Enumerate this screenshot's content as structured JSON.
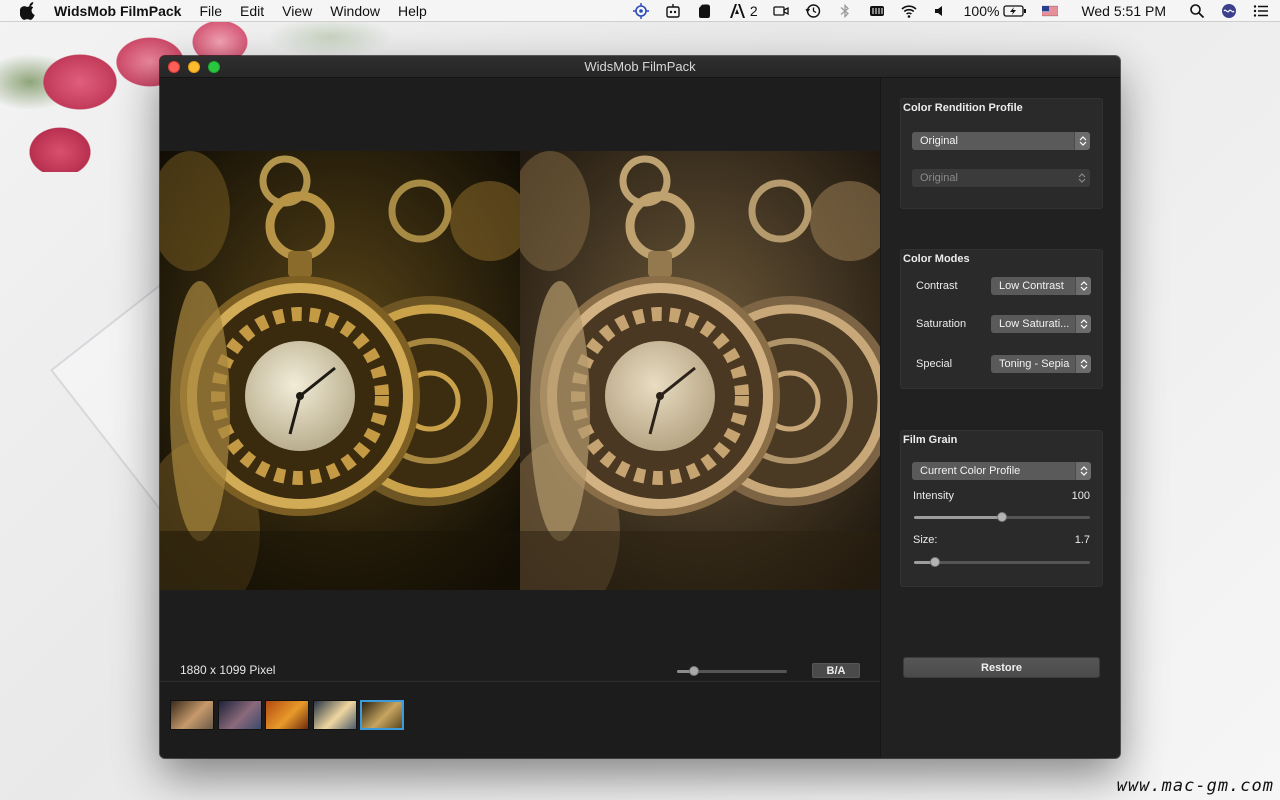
{
  "menubar": {
    "app_name": "WidsMob FilmPack",
    "items": [
      "File",
      "Edit",
      "View",
      "Window",
      "Help"
    ],
    "adobe_count": "2",
    "battery": "100%",
    "clock": "Wed 5:51 PM",
    "status_icons": [
      "location-icon",
      "robot-icon",
      "evernote-icon",
      "adobe-icon",
      "facetime-camera-icon",
      "time-machine-icon",
      "bluetooth-icon",
      "memory-icon",
      "wifi-icon",
      "volume-icon",
      "battery-icon",
      "us-flag-icon",
      "spotlight-icon",
      "siri-icon",
      "notification-center-icon"
    ]
  },
  "window": {
    "title": "WidsMob FilmPack"
  },
  "preview": {
    "pixel_info": "1880 x 1099 Pixel",
    "ba_label": "B/A",
    "zoom_level": 0.15
  },
  "filmstrip": {
    "thumbnails": [
      {
        "name": "thumbnail-interior",
        "colors": [
          "#3a2a1c",
          "#c79a6b",
          "#6b5a48"
        ]
      },
      {
        "name": "thumbnail-city-night",
        "colors": [
          "#1d2238",
          "#8b6a7c",
          "#3c4a6a"
        ]
      },
      {
        "name": "thumbnail-autumn-leaves",
        "colors": [
          "#b34a12",
          "#e89a2a",
          "#6e2a0c"
        ]
      },
      {
        "name": "thumbnail-sunset-lake",
        "colors": [
          "#263444",
          "#f0d7a0",
          "#4b5a6b"
        ]
      },
      {
        "name": "thumbnail-pocket-watches",
        "colors": [
          "#2c2412",
          "#c7a560",
          "#5a4620"
        ]
      }
    ],
    "selected_index": 4
  },
  "panel": {
    "color_rendition": {
      "title": "Color Rendition Profile",
      "profile": "Original",
      "sub_profile": "Original"
    },
    "color_modes": {
      "title": "Color Modes",
      "contrast_label": "Contrast",
      "contrast_value": "Low Contrast",
      "saturation_label": "Saturation",
      "saturation_value": "Low Saturati...",
      "special_label": "Special",
      "special_value": "Toning - Sepia"
    },
    "film_grain": {
      "title": "Film Grain",
      "profile": "Current Color Profile",
      "intensity_label": "Intensity",
      "intensity_value": "100",
      "intensity_fraction": 0.5,
      "size_label": "Size:",
      "size_value": "1.7",
      "size_fraction": 0.12
    },
    "restore_label": "Restore"
  },
  "watermark": "www.mac-gm.com",
  "colors": {
    "window_bg": "#202020",
    "panel_group": "#2a2a2a",
    "selection_blue": "#3d9bdc",
    "sepia_tone": "#b08a55",
    "brass_tone": "#c9a24a"
  }
}
